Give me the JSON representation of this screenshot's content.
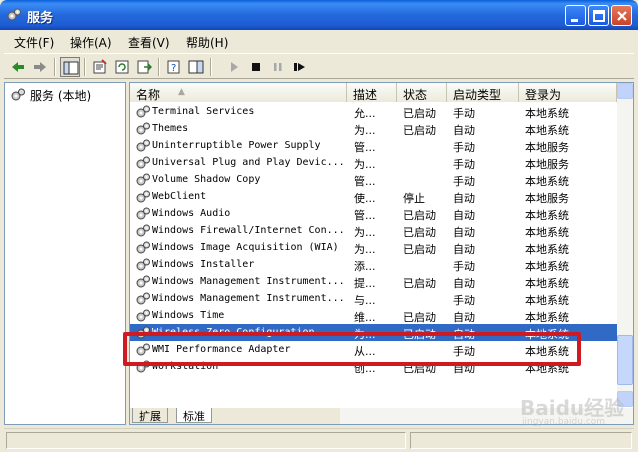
{
  "window": {
    "title": "服务",
    "controls": [
      "minimize-icon",
      "maximize-icon",
      "close-icon"
    ]
  },
  "menu": [
    {
      "label": "文件(F)"
    },
    {
      "label": "操作(A)"
    },
    {
      "label": "查看(V)"
    },
    {
      "label": "帮助(H)"
    }
  ],
  "toolbar": [
    "back-icon",
    "forward-icon",
    "show-tree-icon",
    "properties-icon",
    "refresh-icon",
    "export-icon",
    "help-icon",
    "view-icon",
    "play-icon",
    "stop-icon",
    "pause-icon",
    "restart-icon"
  ],
  "tree": {
    "root": "服务 (本地)"
  },
  "columns": [
    {
      "label": "名称"
    },
    {
      "label": "描述"
    },
    {
      "label": "状态"
    },
    {
      "label": "启动类型"
    },
    {
      "label": "登录为"
    }
  ],
  "services": [
    {
      "name": "Terminal Services",
      "desc": "允...",
      "status": "已启动",
      "startup": "手动",
      "logon": "本地系统"
    },
    {
      "name": "Themes",
      "desc": "为...",
      "status": "已启动",
      "startup": "自动",
      "logon": "本地系统"
    },
    {
      "name": "Uninterruptible Power Supply",
      "desc": "管...",
      "status": "",
      "startup": "手动",
      "logon": "本地服务"
    },
    {
      "name": "Universal Plug and Play Devic...",
      "desc": "为...",
      "status": "",
      "startup": "手动",
      "logon": "本地服务"
    },
    {
      "name": "Volume Shadow Copy",
      "desc": "管...",
      "status": "",
      "startup": "手动",
      "logon": "本地系统"
    },
    {
      "name": "WebClient",
      "desc": "使...",
      "status": "停止",
      "startup": "自动",
      "logon": "本地服务"
    },
    {
      "name": "Windows Audio",
      "desc": "管...",
      "status": "已启动",
      "startup": "自动",
      "logon": "本地系统"
    },
    {
      "name": "Windows Firewall/Internet Con...",
      "desc": "为...",
      "status": "已启动",
      "startup": "自动",
      "logon": "本地系统"
    },
    {
      "name": "Windows Image Acquisition (WIA)",
      "desc": "为...",
      "status": "已启动",
      "startup": "自动",
      "logon": "本地系统"
    },
    {
      "name": "Windows Installer",
      "desc": "添...",
      "status": "",
      "startup": "手动",
      "logon": "本地系统"
    },
    {
      "name": "Windows Management Instrument...",
      "desc": "提...",
      "status": "已启动",
      "startup": "自动",
      "logon": "本地系统"
    },
    {
      "name": "Windows Management Instrument...",
      "desc": "与...",
      "status": "",
      "startup": "手动",
      "logon": "本地系统"
    },
    {
      "name": "Windows Time",
      "desc": "维...",
      "status": "已启动",
      "startup": "自动",
      "logon": "本地系统"
    },
    {
      "name": "Wireless Zero Configuration",
      "desc": "为...",
      "status": "已启动",
      "startup": "自动",
      "logon": "本地系统",
      "selected": true
    },
    {
      "name": "WMI Performance Adapter",
      "desc": "从...",
      "status": "",
      "startup": "手动",
      "logon": "本地系统"
    },
    {
      "name": "Workstation",
      "desc": "创...",
      "status": "已启动",
      "startup": "自动",
      "logon": "本地系统"
    }
  ],
  "tabs": [
    {
      "label": "扩展"
    },
    {
      "label": "标准"
    }
  ],
  "watermark": {
    "brand": "Baidu经验",
    "url": "jingyan.baidu.com"
  },
  "colors": {
    "titlebar": "#2468dc",
    "selection": "#316ac5",
    "highlight": "#d01a22"
  }
}
